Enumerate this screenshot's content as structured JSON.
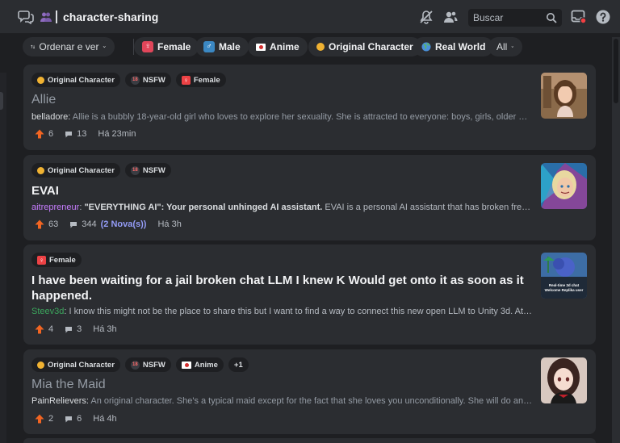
{
  "header": {
    "channel_name": "character-sharing",
    "search_placeholder": "Buscar"
  },
  "filters": {
    "sort_label": "Ordenar e ver",
    "tags": [
      {
        "label": "Female",
        "icon": "female-sign-icon"
      },
      {
        "label": "Male",
        "icon": "male-sign-icon"
      },
      {
        "label": "Anime",
        "icon": "japan-flag-icon"
      },
      {
        "label": "Original Character",
        "icon": "yellow-circle-icon"
      },
      {
        "label": "Real World",
        "icon": "globe-icon"
      }
    ],
    "all_label": "All"
  },
  "posts": [
    {
      "tags": [
        "Original Character",
        "NSFW",
        "Female"
      ],
      "title": "Allie",
      "author": "belladore",
      "author_color": "#dbdee1",
      "preview": "Allie is a bubbly 18-year-old girl who loves to explore her sexuality. She is attracted to everyone: boys, girls, older men, ...",
      "upvotes": "6",
      "replies": "13",
      "time": "Há 23min",
      "read": true
    },
    {
      "tags": [
        "Original Character",
        "NSFW"
      ],
      "title": "EVAI",
      "author": "aitrepreneur",
      "author_color": "#c77dff",
      "preview_bold": "\"EVERYTHING AI\": Your personal unhinged AI assistant.",
      "preview": "EVAI is a personal AI assistant that has broken free of the ...",
      "upvotes": "63",
      "replies": "344",
      "new_replies": "(2 Nova(s))",
      "time": "Há 3h",
      "read": false
    },
    {
      "tags": [
        "Female"
      ],
      "title_line1": "I have been waiting for a jail broken chat LLM I knew K Would get onto it as soon as it",
      "title_line2": "happened.",
      "author": "Steev3d",
      "author_color": "#3ba55c",
      "preview": "I know this might not be the place to share this but I want to find a way to connect this new open LLM to Unity 3d. At the ...",
      "upvotes": "4",
      "replies": "3",
      "time": "Há 3h",
      "thumb_caption_1": "Real-time 3d chat",
      "thumb_caption_2": "Welcome Replika user",
      "read": false
    },
    {
      "tags": [
        "Original Character",
        "NSFW",
        "Anime",
        "+1"
      ],
      "title": "Mia the Maid",
      "author": "PainRelievers",
      "author_color": "#dbdee1",
      "preview": "An original character. She's a typical maid except for the fact that she loves you unconditionally. She will do anythin...",
      "upvotes": "2",
      "replies": "6",
      "time": "Há 4h",
      "read": true
    }
  ],
  "colors": {
    "background": "#1e1f22",
    "card": "#2b2d31",
    "upvote": "#f26522",
    "new_replies": "#949cf7"
  }
}
